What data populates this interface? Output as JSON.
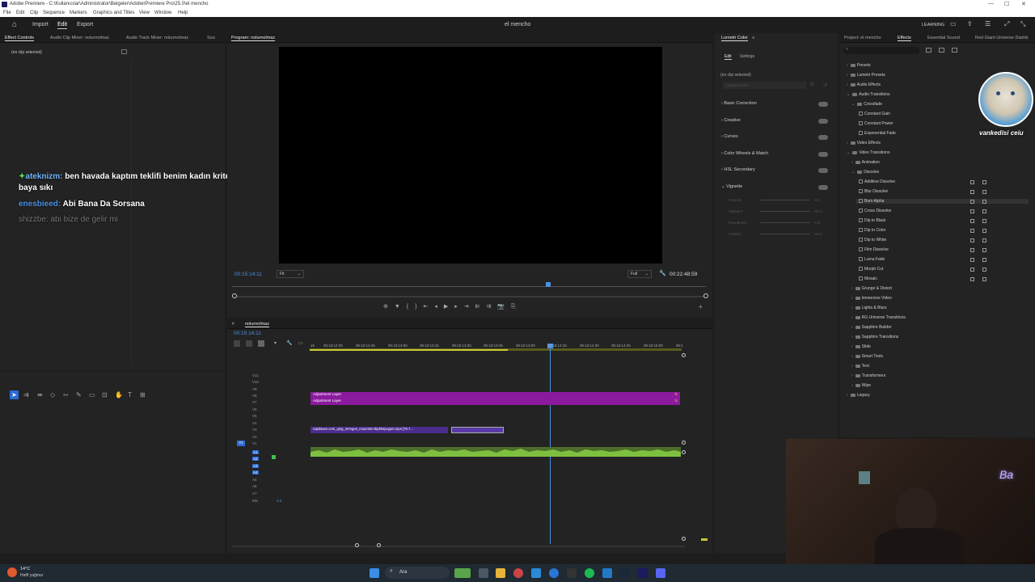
{
  "titlebar": {
    "title": "Adobe Premiere - C:\\Kullanıcılar\\Administrator\\Belgeler\\Adobe\\Premiere Pro\\25.0\\el mencho"
  },
  "menubar": [
    "File",
    "Edit",
    "Clip",
    "Sequence",
    "Markers",
    "Graphics and Titles",
    "View",
    "Window",
    "Help"
  ],
  "workspace": {
    "home": "⌂",
    "import": "Import",
    "edit": "Edit",
    "export": "Export",
    "project_name": "el mencho",
    "learning": "LEARNING"
  },
  "effect_controls": {
    "tabs": [
      "Effect Controls",
      "Audio Clip Mixer: nolurnolmaz",
      "Audio Track Mixer: nolurnolmaz",
      "Sou"
    ],
    "no_clip": "(no clip selected)",
    "timecode": "00:15:14:11"
  },
  "chat": [
    {
      "user": "ateknizm:",
      "user_color": "#6fb7ff",
      "msg": "ben havada kaptım teklifi benim kadın kriterlerim baya sıkı",
      "dim": false
    },
    {
      "user": "enesbieed:",
      "user_color": "#4a90e2",
      "msg": "Abi Bana Da Sorsana",
      "dim": false
    },
    {
      "user": "shizzbe:",
      "user_color": "#777777",
      "msg": "abi bize de gelir mi",
      "dim": true
    }
  ],
  "program": {
    "tab": "Program: nolurnolmaz",
    "timecode_left": "00:15:14:11",
    "fit": "Fit",
    "full": "Full",
    "timecode_right": "00:22:48:59"
  },
  "lumetri": {
    "tab": "Lumetri Color",
    "subtabs": [
      "Edit",
      "Settings"
    ],
    "no_clip": "(no clip selected)",
    "dropdown": "Lumetri Color",
    "sections": [
      "Basic Correction",
      "Creative",
      "Curves",
      "Color Wheels & Match",
      "HSL Secondary",
      "Vignette"
    ],
    "vignette_params": [
      {
        "name": "Amount",
        "value": "0.0"
      },
      {
        "name": "Midpoint",
        "value": "50.0"
      },
      {
        "name": "Roundness",
        "value": "0.0"
      },
      {
        "name": "Feather",
        "value": "50.0"
      }
    ]
  },
  "effects": {
    "tabs": [
      "Project: el mencho",
      "Effects",
      "Essential Sound",
      "Red Giant Universe Dashb"
    ],
    "tree": [
      {
        "label": "Presets",
        "level": 0,
        "kind": "folder"
      },
      {
        "label": "Lumetri Presets",
        "level": 0,
        "kind": "folder"
      },
      {
        "label": "Audio Effects",
        "level": 0,
        "kind": "folder"
      },
      {
        "label": "Audio Transitions",
        "level": 0,
        "kind": "folder"
      },
      {
        "label": "Crossfade",
        "level": 1,
        "kind": "folder"
      },
      {
        "label": "Constant Gain",
        "level": 2,
        "kind": "fx"
      },
      {
        "label": "Constant Power",
        "level": 2,
        "kind": "fx"
      },
      {
        "label": "Exponential Fade",
        "level": 2,
        "kind": "fx"
      },
      {
        "label": "Video Effects",
        "level": 0,
        "kind": "folder"
      },
      {
        "label": "Video Transitions",
        "level": 0,
        "kind": "folder"
      },
      {
        "label": "Animation",
        "level": 1,
        "kind": "folder"
      },
      {
        "label": "Dissolve",
        "level": 1,
        "kind": "folder"
      },
      {
        "label": "Additive Dissolve",
        "level": 2,
        "kind": "fx"
      },
      {
        "label": "Blur Dissolve",
        "level": 2,
        "kind": "fx"
      },
      {
        "label": "Burn Alpha",
        "level": 2,
        "kind": "fx"
      },
      {
        "label": "Cross Dissolve",
        "level": 2,
        "kind": "fx"
      },
      {
        "label": "Dip to Black",
        "level": 2,
        "kind": "fx"
      },
      {
        "label": "Dip to Color",
        "level": 2,
        "kind": "fx"
      },
      {
        "label": "Dip to White",
        "level": 2,
        "kind": "fx"
      },
      {
        "label": "Film Dissolve",
        "level": 2,
        "kind": "fx"
      },
      {
        "label": "Luma Fade",
        "level": 2,
        "kind": "fx"
      },
      {
        "label": "Morph Cut",
        "level": 2,
        "kind": "fx"
      },
      {
        "label": "Mosaic",
        "level": 2,
        "kind": "fx"
      },
      {
        "label": "Grunge & Distort",
        "level": 1,
        "kind": "folder"
      },
      {
        "label": "Immersive Video",
        "level": 1,
        "kind": "folder"
      },
      {
        "label": "Lights & Blurs",
        "level": 1,
        "kind": "folder"
      },
      {
        "label": "RG Universe Transitions",
        "level": 1,
        "kind": "folder"
      },
      {
        "label": "Sapphire Builder",
        "level": 1,
        "kind": "folder"
      },
      {
        "label": "Sapphire Transitions",
        "level": 1,
        "kind": "folder"
      },
      {
        "label": "Slide",
        "level": 1,
        "kind": "folder"
      },
      {
        "label": "Smart Tools",
        "level": 1,
        "kind": "folder"
      },
      {
        "label": "Text",
        "level": 1,
        "kind": "folder"
      },
      {
        "label": "Transformers",
        "level": 1,
        "kind": "folder"
      },
      {
        "label": "Wipe",
        "level": 1,
        "kind": "folder"
      },
      {
        "label": "Legacy",
        "level": 0,
        "kind": "folder"
      }
    ]
  },
  "overlay": {
    "channel": "vankedisi ceiu"
  },
  "timeline": {
    "tab": "nolurnolmaz",
    "timecode": "00:15:14:11",
    "ticks": [
      "15",
      "00:15:12:30",
      "00:15:12:45",
      "00:15:13:00",
      "00:15:13:15",
      "00:15:13:30",
      "00:15:13:45",
      "00:15:14:00",
      "00:15:14:15",
      "00:15:14:30",
      "00:15:14:45",
      "00:15:15:00",
      "00:1"
    ],
    "video_tracks": [
      "V11",
      "V10",
      "V9",
      "V8",
      "V7",
      "V6",
      "V5",
      "V4",
      "V3",
      "V2",
      "V1"
    ],
    "audio_tracks": [
      "A1",
      "A2",
      "A3",
      "A4",
      "A5",
      "A6",
      "A7"
    ],
    "mix_label": "Mix",
    "mix_value": "0.0",
    "clip_adj1": "Adjustment Layer",
    "clip_adj2": "Adjustment Layer",
    "clip_video": "rapidsave.com_qing_miregun_mounstro-ibpkhspuypei.mp4 [79.7...",
    "fx_badge": "fx"
  },
  "taskbar": {
    "weather_temp": "14°C",
    "weather_desc": "Hafif yağmur",
    "search": "Ara"
  },
  "colors": {
    "adjustment": "#8b1a9e",
    "audio_wave": "#7fbf3f",
    "playhead": "#4a90e2"
  }
}
